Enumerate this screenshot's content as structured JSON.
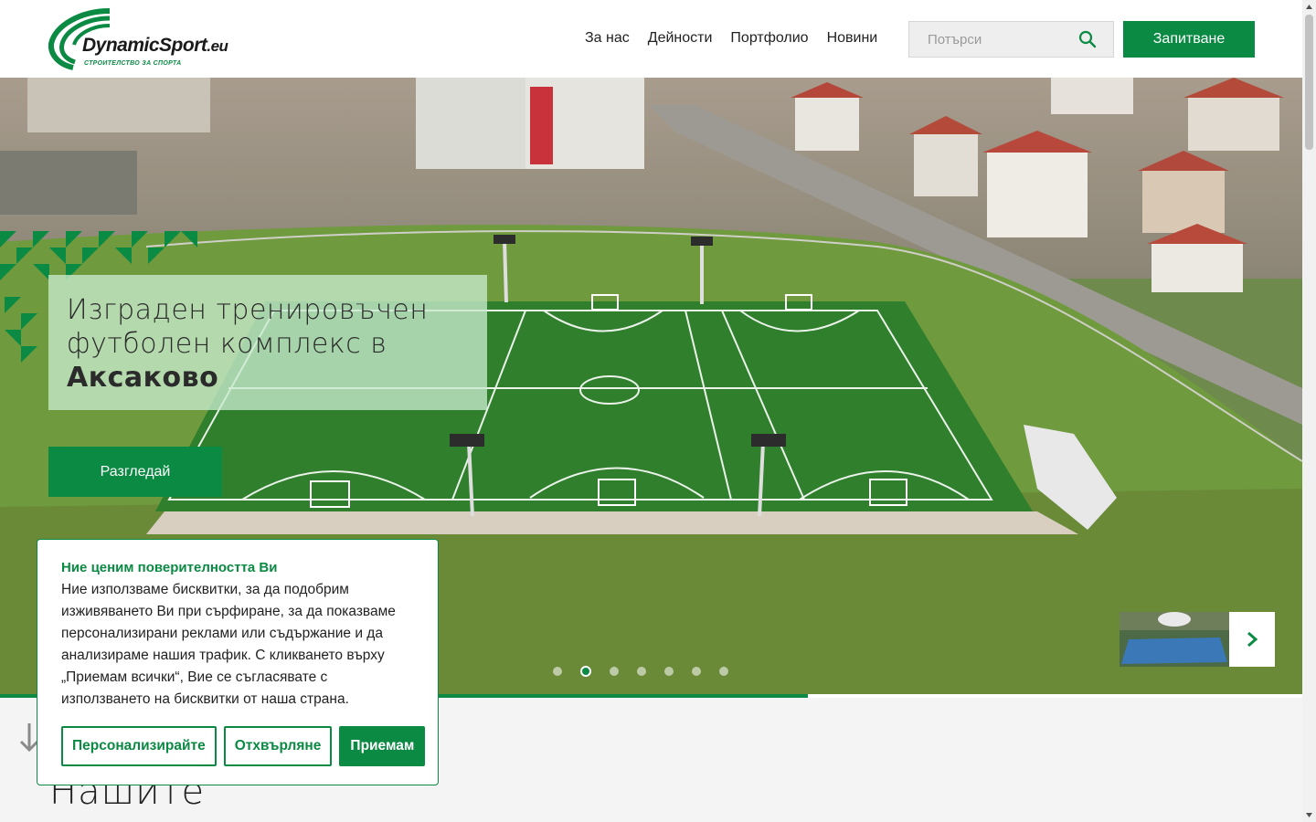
{
  "brand": {
    "name": "DynamicSport",
    "tld": ".eu",
    "tagline": "СТРОИТЕЛСТВО ЗА СПОРТА"
  },
  "nav": {
    "items": [
      {
        "label": "За нас"
      },
      {
        "label": "Дейности"
      },
      {
        "label": "Портфолио"
      },
      {
        "label": "Новини"
      }
    ]
  },
  "search": {
    "placeholder": "Потърси",
    "icon": "search-icon"
  },
  "header": {
    "cta_label": "Запитване"
  },
  "hero": {
    "title_line1": "Изграден тренировъчен",
    "title_line2": "футболен комплекс в",
    "title_bold": "Аксаково",
    "button_label": "Разгледай",
    "slide_count": 7,
    "active_slide": 2,
    "progress_percent": 62,
    "next_icon": "chevron-right-icon"
  },
  "section": {
    "title": "Нашите"
  },
  "cookie": {
    "title": "Ние ценим поверителността Ви",
    "text": "Ние използваме бисквитки, за да подобрим изживяването Ви при сърфиране, за да показваме персонализирани реклами или съдържание и да анализираме нашия трафик. С кликването върху „Приемам всички“, Вие се съгласявате с използването на бисквитки от наша страна.",
    "customize_label": "Персонализирайте",
    "reject_label": "Отхвърляне",
    "accept_label": "Приемам"
  },
  "colors": {
    "brand_green": "#0b8a43",
    "header_bg": "#ffffff",
    "page_bg": "#f4f4f4"
  }
}
